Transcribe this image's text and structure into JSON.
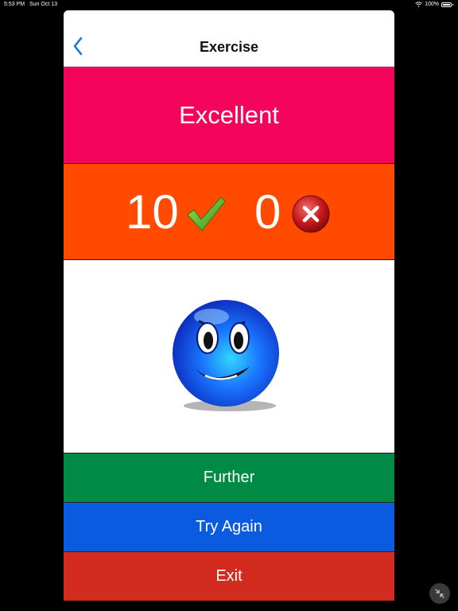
{
  "status_bar": {
    "time": "5:53 PM",
    "date": "Sun Oct 13",
    "battery": "100%"
  },
  "nav": {
    "title": "Exercise",
    "back_icon": "chevron-left-icon"
  },
  "result": {
    "label": "Excellent",
    "correct": "10",
    "wrong": "0"
  },
  "buttons": {
    "further": "Further",
    "try_again": "Try Again",
    "exit": "Exit"
  },
  "colors": {
    "banner": "#f4045a",
    "score_row": "#ff4a00",
    "further": "#008a46",
    "try_again": "#0a5be0",
    "exit": "#d42b21",
    "accent": "#1a73e8"
  }
}
